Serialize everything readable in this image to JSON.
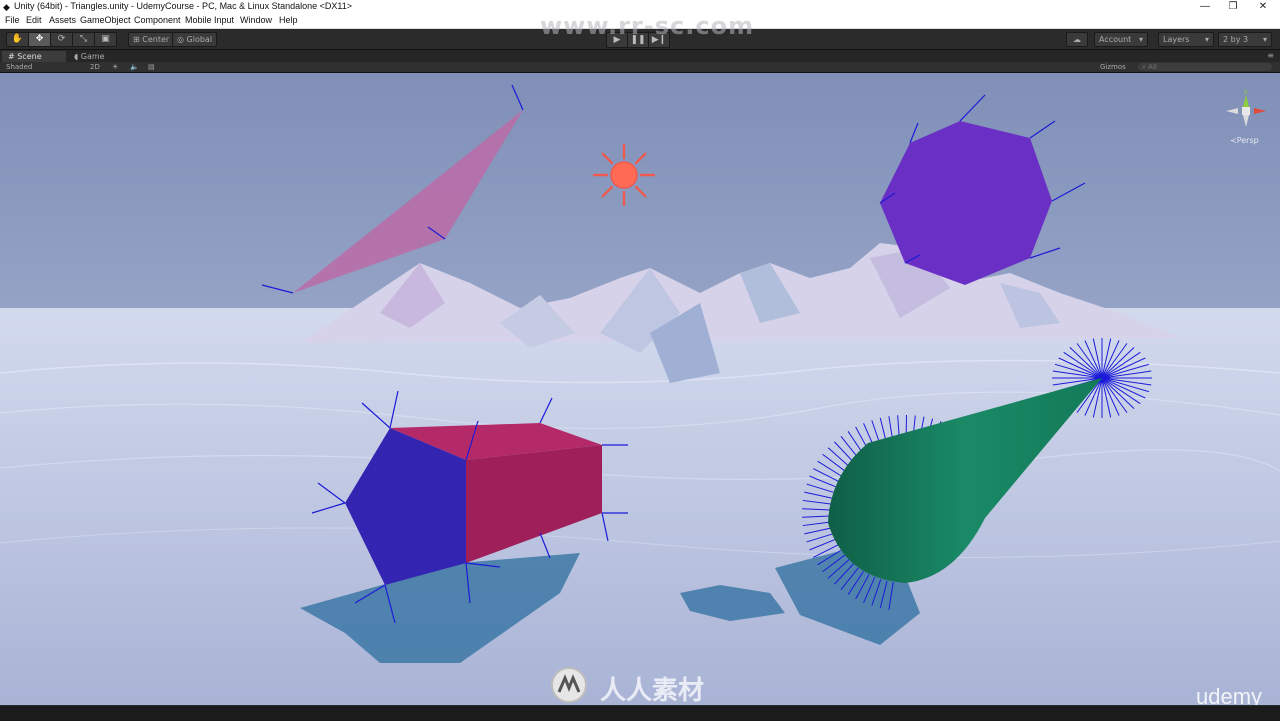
{
  "window": {
    "title": "Unity (64bit) - Triangles.unity - UdemyCourse - PC, Mac & Linux Standalone <DX11>",
    "minimize": "—",
    "maximize": "❐",
    "close": "✕"
  },
  "menu": [
    "File",
    "Edit",
    "Assets",
    "GameObject",
    "Component",
    "Mobile Input",
    "Window",
    "Help"
  ],
  "toolbar": {
    "tools": [
      {
        "name": "hand-tool",
        "glyph": "✋"
      },
      {
        "name": "move-tool",
        "glyph": "✥"
      },
      {
        "name": "rotate-tool",
        "glyph": "⟳"
      },
      {
        "name": "scale-tool",
        "glyph": "⤡"
      },
      {
        "name": "rect-tool",
        "glyph": "▣"
      }
    ],
    "pivot_label": "Center",
    "space_label": "Global",
    "play_glyph": "▶",
    "pause_glyph": "❚❚",
    "step_glyph": "▶❙",
    "cloud_glyph": "☁",
    "account_label": "Account",
    "layers_label": "Layers",
    "layout_label": "2 by 3"
  },
  "tabs": [
    {
      "label": "Scene",
      "active": true
    },
    {
      "label": "Game",
      "active": false
    }
  ],
  "scene_bar": {
    "shading": "Shaded",
    "mode_2d": "2D",
    "gizmos": "Gizmos",
    "search_placeholder": "All"
  },
  "viewport": {
    "projection_label": "Persp",
    "sky_top": "#7f8fb7",
    "sky_horizon": "#b7c4de",
    "ground": "#c5cde6",
    "normal_color": "#1b1bd8"
  },
  "watermarks": {
    "url": "www.rr-sc.com",
    "cn": "人人素材",
    "brand": "udemy"
  }
}
